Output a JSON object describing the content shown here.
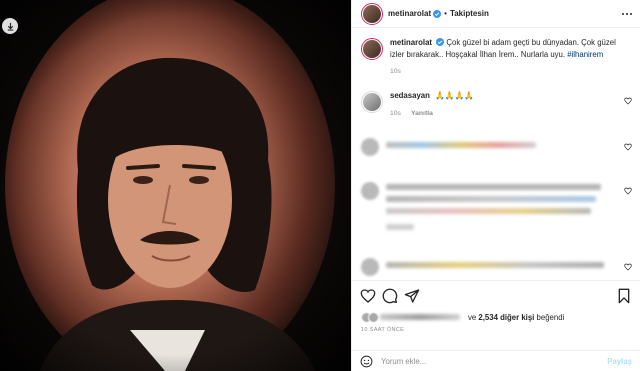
{
  "post": {
    "author": "metinarolat",
    "follow_state": "Takiptesin",
    "separator": "•"
  },
  "caption": {
    "username": "metinarolat",
    "text": "Çok güzel bi adam geçti bu dünyadan. Çok güzel izler bırakarak.. Hoşçakal İlhan İrem.. Nurlarla uyu.",
    "hashtag": "#ilhanirem",
    "time": "10s"
  },
  "comment_1": {
    "username": "sedasayan",
    "text": "🙏🙏🙏🙏",
    "time": "10s",
    "reply_label": "Yanıtla"
  },
  "likes": {
    "conjunction": "ve",
    "count_text": "2,534 diğer kişi",
    "suffix": "beğendi"
  },
  "timestamp": "10 SAAT ÖNCE",
  "composer": {
    "placeholder": "Yorum ekle...",
    "post_label": "Paylaş"
  },
  "icons": {
    "verified": "verified-badge-icon",
    "more": "more-options-icon",
    "like": "heart-icon",
    "comment": "comment-icon",
    "share": "share-icon",
    "save": "bookmark-icon",
    "emoji": "emoji-icon",
    "download": "download-icon"
  },
  "colors": {
    "verified": "#3897f0",
    "hashtag": "#00376b",
    "post_button": "#b2dffc",
    "muted": "#8e8e8e"
  }
}
